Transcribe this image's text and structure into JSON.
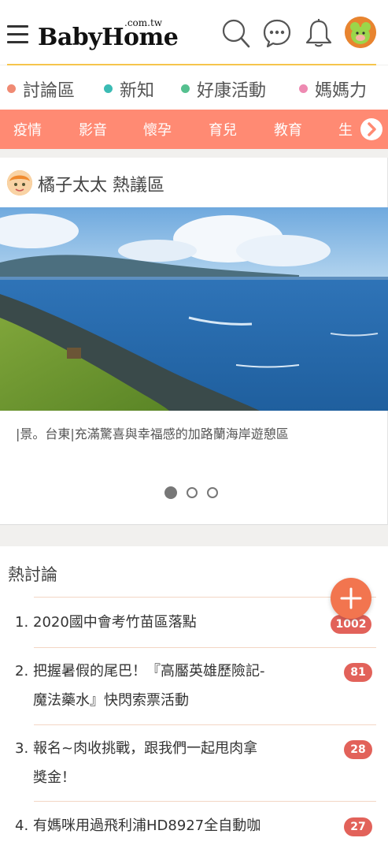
{
  "header": {
    "logo_text": "BabyHome",
    "logo_domain": ".com.tw"
  },
  "nav": {
    "categories": [
      {
        "label": "討論區",
        "color": "#f08a73"
      },
      {
        "label": "新知",
        "color": "#3bbbb4"
      },
      {
        "label": "好康活動",
        "color": "#55c08f"
      },
      {
        "label": "媽媽力",
        "color": "#ee8ab2"
      }
    ],
    "tags": [
      "疫情",
      "影音",
      "懷孕",
      "育兒",
      "教育",
      "生"
    ]
  },
  "hot_zone": {
    "title": "橘子太太 熱議區",
    "caption": "|景。台東|充滿驚喜與幸福感的加路蘭海岸遊憩區",
    "active_slide": 1,
    "slide_count": 3
  },
  "discussions": {
    "title": "熱討論",
    "items": [
      {
        "rank": "1.",
        "line1": "2020國中會考竹苗區落點",
        "line2": "",
        "count": "1002"
      },
      {
        "rank": "2.",
        "line1": "把握暑假的尾巴！『高靨英雄歷險記-",
        "line2": "魔法藥水』快閃索票活動",
        "count": "81"
      },
      {
        "rank": "3.",
        "line1": "報名~肉收挑戰，跟我們一起甩肉拿",
        "line2": "獎金！",
        "count": "28"
      },
      {
        "rank": "4.",
        "line1": "有媽咪用過飛利浦HD8927全自動咖",
        "line2": "",
        "count": "27"
      }
    ]
  },
  "colors": {
    "accent_orange": "#ff8a73",
    "gold_line": "#f6c54c",
    "badge_red": "#e2625a",
    "fab": "#f2754f"
  }
}
